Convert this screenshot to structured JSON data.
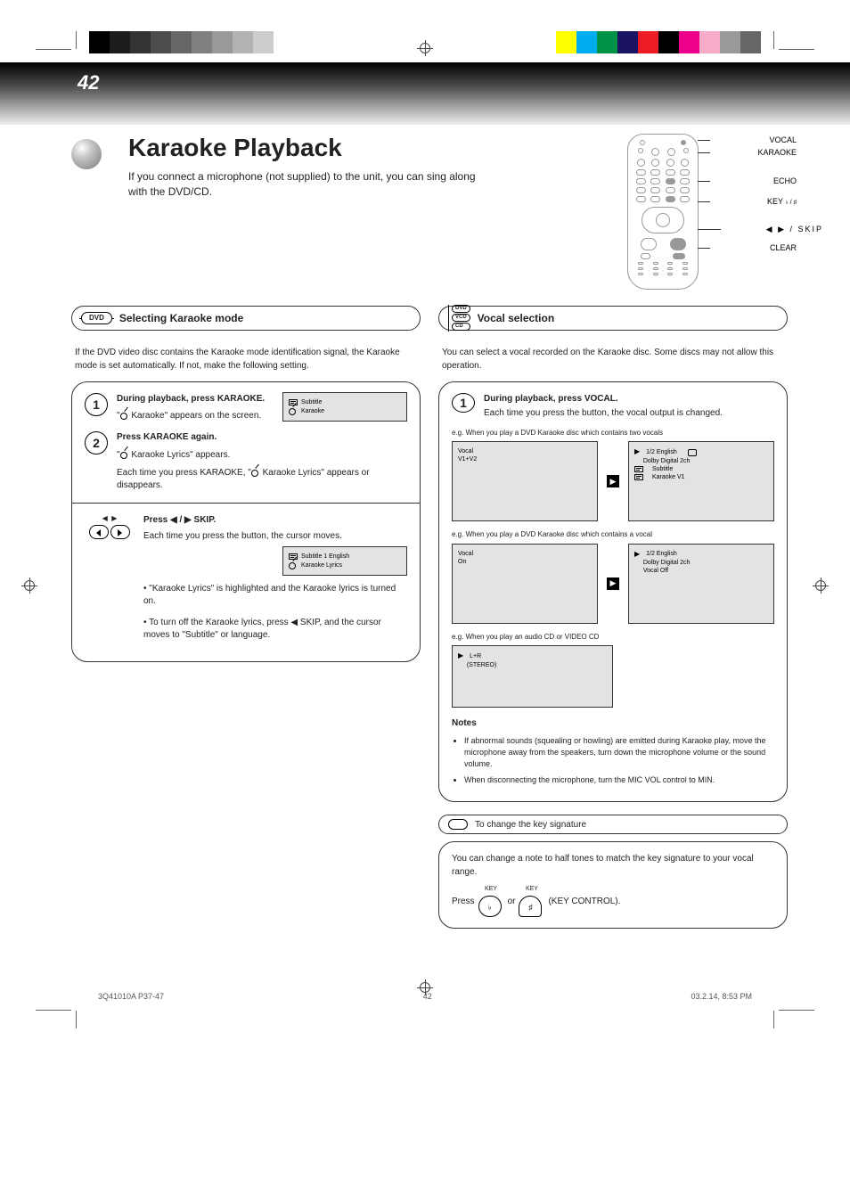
{
  "page_number_large": "42",
  "footer": {
    "left": "42",
    "date": "03.2.14, 8:53 PM",
    "file": "3Q41010A P37-47"
  },
  "title": "Karaoke Playback",
  "subtitle": "If you connect a microphone (not supplied) to the unit, you can sing along with the DVD/CD.",
  "remote_labels": {
    "vocal": "VOCAL",
    "karaoke": "KARAOKE",
    "echo": "ECHO",
    "skip": "/ SKIP",
    "clear": "CLEAR"
  },
  "section_dvd": "Selecting Karaoke mode",
  "section_vcd": "Vocal selection",
  "section_clear": "To change the key signature",
  "dvd_intro": "If the DVD video disc contains the Karaoke mode identification signal, the Karaoke mode is set automatically. If not, make the following setting.",
  "dvd_step1_line1": "During playback, press KARAOKE.",
  "dvd_step1_line2": "\"   Karaoke\" appears on the screen.",
  "dvd_step2": "Press KARAOKE again.",
  "dvd_shot1_label": "Subtitle",
  "dvd_shot1_value": "Karaoke",
  "dvd_step2_label": "Subtitle",
  "dvd_step2_value": "Karaoke Lyrics",
  "dvd_note_lyrics": "\"   Karaoke Lyrics\" appears.",
  "dvd_note_off": "Each time you press KARAOKE, \"   Karaoke Lyrics\" appears or disappears.",
  "dvd_b_title": "Press ◀ / ▶ SKIP.",
  "dvd_b_body": "Each time you press the button, the cursor moves.",
  "dvd_b_shot_lines": [
    "Subtitle   1 English",
    "Karaoke Lyrics"
  ],
  "dvd_b_note1": "• \"Karaoke Lyrics\" is highlighted and the Karaoke lyrics is turned on.",
  "dvd_b_note2": "• To turn off the Karaoke lyrics, press ◀ SKIP, and the cursor moves to \"Subtitle\" or language.",
  "vcd_intro": "You can select a vocal recorded on the Karaoke disc. Some discs may not allow this operation.",
  "vcd_step_line1": "During playback, press VOCAL.",
  "vcd_step_line2": "Each time you press the button, the vocal output is changed.",
  "vcd_eg1": "e.g. When you play a DVD Karaoke disc which contains two vocals",
  "vcd_eg2": "e.g. When you play a DVD Karaoke disc which contains a vocal",
  "vcd_eg3": "e.g. When you play an audio CD or VIDEO CD",
  "vcd_shot1_a_lines": [
    "Vocal",
    "V1+V2"
  ],
  "vcd_shot1_b_lines": [
    "1/2 English",
    "Dolby Digital 2ch",
    "Subtitle",
    "Karaoke  V1"
  ],
  "vcd_shot2_a_lines": [
    "Vocal",
    "On"
  ],
  "vcd_shot2_b_lines": [
    "1/2 English",
    "Dolby Digital 2ch",
    "Vocal Off"
  ],
  "vcd_shot3_lines": [
    "L+R",
    "(STEREO)"
  ],
  "notes_title": "Notes",
  "notes": [
    "If abnormal sounds (squealing or howling) are emitted during Karaoke play, move the microphone away from the speakers, turn down the microphone volume or the sound volume.",
    "When disconnecting the microphone, turn the MIC VOL control to MIN."
  ],
  "clear_body": "You can change a note to half tones to match the key signature to your vocal range.",
  "clear_step_prefix": "Press",
  "clear_step_btn_key": "KEY",
  "clear_step_btn_flat": "♭",
  "clear_step_or": "or",
  "clear_step_btn_sharp": "♯",
  "clear_step_suffix": "(KEY CONTROL).",
  "colors": {
    "gray_steps": [
      "#000",
      "#1c1c1c",
      "#333",
      "#4d4d4d",
      "#666",
      "#808080",
      "#999",
      "#b3b3b3",
      "#ccc",
      "#fff"
    ],
    "hue_steps": [
      "#ffff00",
      "#00aeef",
      "#009245",
      "#1b1464",
      "#ed1c24",
      "#000",
      "#ec008c",
      "#f7adc9",
      "#999",
      "#666"
    ]
  }
}
